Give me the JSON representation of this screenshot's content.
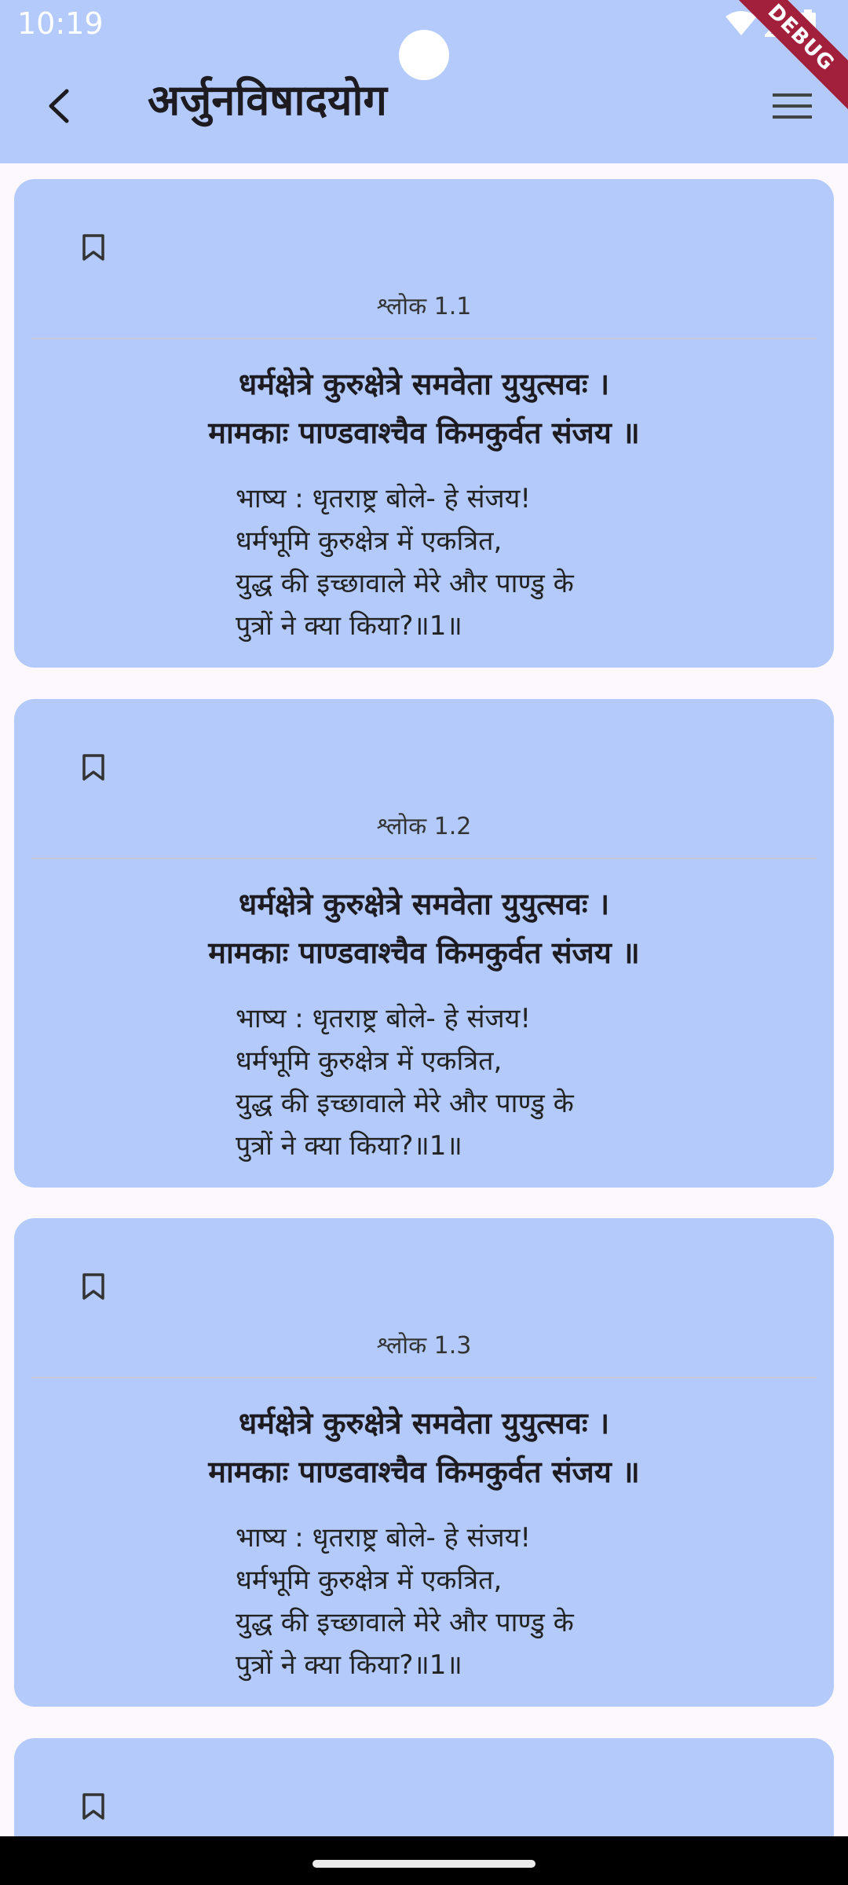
{
  "status_bar": {
    "time": "10:19"
  },
  "app_bar": {
    "title": "अर्जुनविषादयोग",
    "back_icon": "chevron-left-icon",
    "menu_icon": "menu-icon",
    "debug_label": "DEBUG"
  },
  "colors": {
    "primary_container": "#b3cafb",
    "background": "#fdf8fd",
    "debug_banner": "#a3203d"
  },
  "cards": [
    {
      "label": "श्लोक 1.1",
      "verse_line1": "धर्मक्षेत्रे कुरुक्षेत्रे समवेता युयुत्सवः ।",
      "verse_line2": "मामकाः पाण्डवाश्चैव किमकुर्वत संजय ॥",
      "bhashya": [
        "भाष्य : धृतराष्ट्र बोले- हे संजय!",
        "धर्मभूमि कुरुक्षेत्र में एकत्रित,",
        "युद्ध की इच्छावाले मेरे और पाण्डु के",
        "पुत्रों ने क्या किया?॥1॥"
      ]
    },
    {
      "label": "श्लोक 1.2",
      "verse_line1": "धर्मक्षेत्रे कुरुक्षेत्रे समवेता युयुत्सवः ।",
      "verse_line2": "मामकाः पाण्डवाश्चैव किमकुर्वत संजय ॥",
      "bhashya": [
        "भाष्य : धृतराष्ट्र बोले- हे संजय!",
        "धर्मभूमि कुरुक्षेत्र में एकत्रित,",
        "युद्ध की इच्छावाले मेरे और पाण्डु के",
        "पुत्रों ने क्या किया?॥1॥"
      ]
    },
    {
      "label": "श्लोक 1.3",
      "verse_line1": "धर्मक्षेत्रे कुरुक्षेत्रे समवेता युयुत्सवः ।",
      "verse_line2": "मामकाः पाण्डवाश्चैव किमकुर्वत संजय ॥",
      "bhashya": [
        "भाष्य : धृतराष्ट्र बोले- हे संजय!",
        "धर्मभूमि कुरुक्षेत्र में एकत्रित,",
        "युद्ध की इच्छावाले मेरे और पाण्डु के",
        "पुत्रों ने क्या किया?॥1॥"
      ]
    }
  ],
  "bookmark_icon": "bookmark-icon"
}
